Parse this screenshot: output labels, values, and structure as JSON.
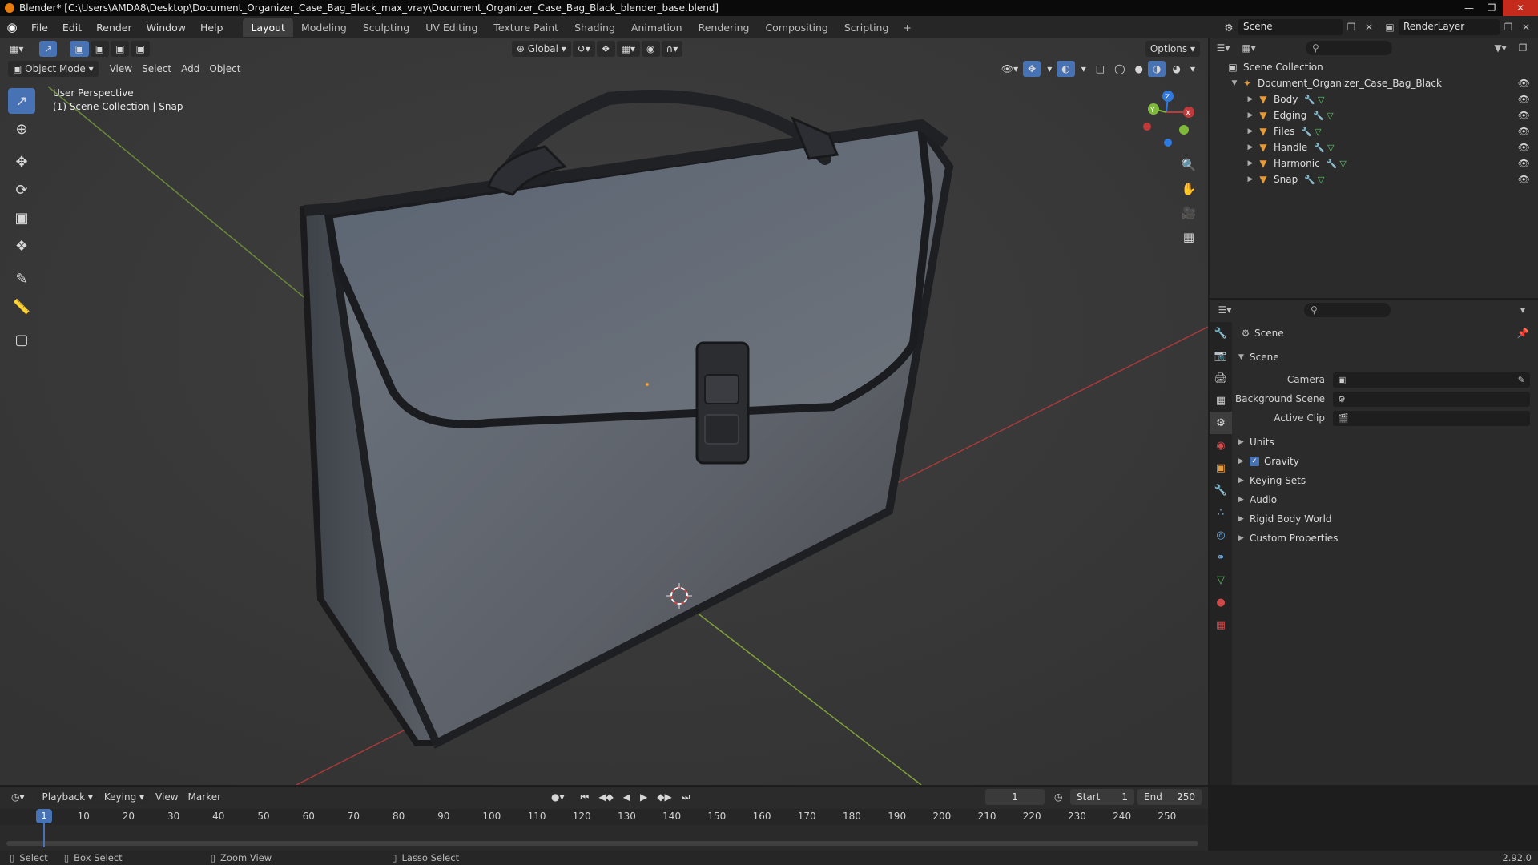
{
  "titlebar": {
    "title": "Blender* [C:\\Users\\AMDA8\\Desktop\\Document_Organizer_Case_Bag_Black_max_vray\\Document_Organizer_Case_Bag_Black_blender_base.blend]"
  },
  "menu": {
    "file": "File",
    "edit": "Edit",
    "render": "Render",
    "window": "Window",
    "help": "Help"
  },
  "workspaces": [
    "Layout",
    "Modeling",
    "Sculpting",
    "UV Editing",
    "Texture Paint",
    "Shading",
    "Animation",
    "Rendering",
    "Compositing",
    "Scripting"
  ],
  "scene_selector": "Scene",
  "renderlayer_selector": "RenderLayer",
  "viewport": {
    "orientation": "Global",
    "options": "Options",
    "mode": "Object Mode",
    "view": "View",
    "select": "Select",
    "add": "Add",
    "object": "Object",
    "info_line1": "User Perspective",
    "info_line2": "(1) Scene Collection | Snap",
    "gizmo": {
      "z": "Z",
      "y": "Y",
      "x": "X"
    }
  },
  "outliner": {
    "root": "Scene Collection",
    "collection": "Document_Organizer_Case_Bag_Black",
    "objects": [
      "Body",
      "Edging",
      "Files",
      "Handle",
      "Harmonic",
      "Snap"
    ]
  },
  "properties": {
    "context": "Scene",
    "section": "Scene",
    "fields": [
      {
        "label": "Camera",
        "value": ""
      },
      {
        "label": "Background Scene",
        "value": ""
      },
      {
        "label": "Active Clip",
        "value": ""
      }
    ],
    "panels": [
      "Units",
      "Gravity",
      "Keying Sets",
      "Audio",
      "Rigid Body World",
      "Custom Properties"
    ],
    "gravity_checked": true
  },
  "timeline": {
    "playback": "Playback",
    "keying": "Keying",
    "view": "View",
    "marker": "Marker",
    "current_frame": "1",
    "start_label": "Start",
    "start": "1",
    "end_label": "End",
    "end": "250",
    "ruler": [
      "1",
      "10",
      "20",
      "30",
      "40",
      "50",
      "60",
      "70",
      "80",
      "90",
      "100",
      "110",
      "120",
      "130",
      "140",
      "150",
      "160",
      "170",
      "180",
      "190",
      "200",
      "210",
      "220",
      "230",
      "240",
      "250"
    ]
  },
  "status": {
    "select": "Select",
    "box_select": "Box Select",
    "zoom_view": "Zoom View",
    "lasso_select": "Lasso Select",
    "version": "2.92.0"
  },
  "colors": {
    "accent": "#4772b3",
    "object_orange": "#e59a3a",
    "x_axis": "#d03a3a",
    "y_axis": "#7fb93a",
    "z_axis": "#2f7ae0"
  }
}
